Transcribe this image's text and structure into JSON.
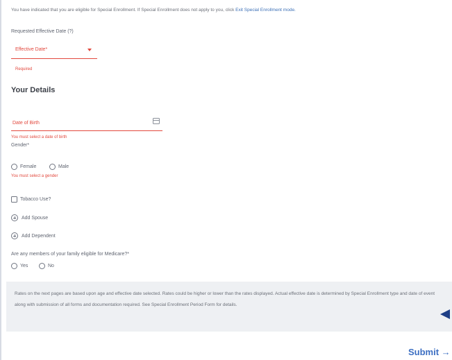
{
  "notice": {
    "text": "You have indicated that you are eligible for Special Enrollment. If Special Enrollment does not apply to you, click",
    "link": "Exit Special Enrollment mode."
  },
  "effective_date": {
    "label": "Requested Effective Date (?)",
    "select_value": "Effective Date*",
    "error": "Required"
  },
  "details": {
    "title": "Your Details",
    "dob_placeholder": "Date of Birth",
    "dob_error": "You must select a date of birth",
    "gender_label": "Gender*",
    "gender_options": [
      "Female",
      "Male"
    ],
    "gender_error": "You must select a gender",
    "tobacco_label": "Tobacco Use?",
    "add_spouse": "Add Spouse",
    "add_dependent": "Add Dependent",
    "medicare_question": "Are any members of your family eligible for Medicare?*",
    "medicare_options": [
      "Yes",
      "No"
    ]
  },
  "disclaimer": "Rates on the next pages are based upon age and effective date selected. Rates could be higher or lower than the rates displayed. Actual effective date is determined by Special Enrollment type and date of event along with submission of all forms and documentation required. See Special Enrollment Period Form for details.",
  "submit_label": "Submit →",
  "colors": {
    "error": "#e2483d",
    "link": "#3b6fb6",
    "submit": "#3d6fc2",
    "disclaimer_bg": "#eef0f3",
    "pointer": "#1e3f86"
  }
}
